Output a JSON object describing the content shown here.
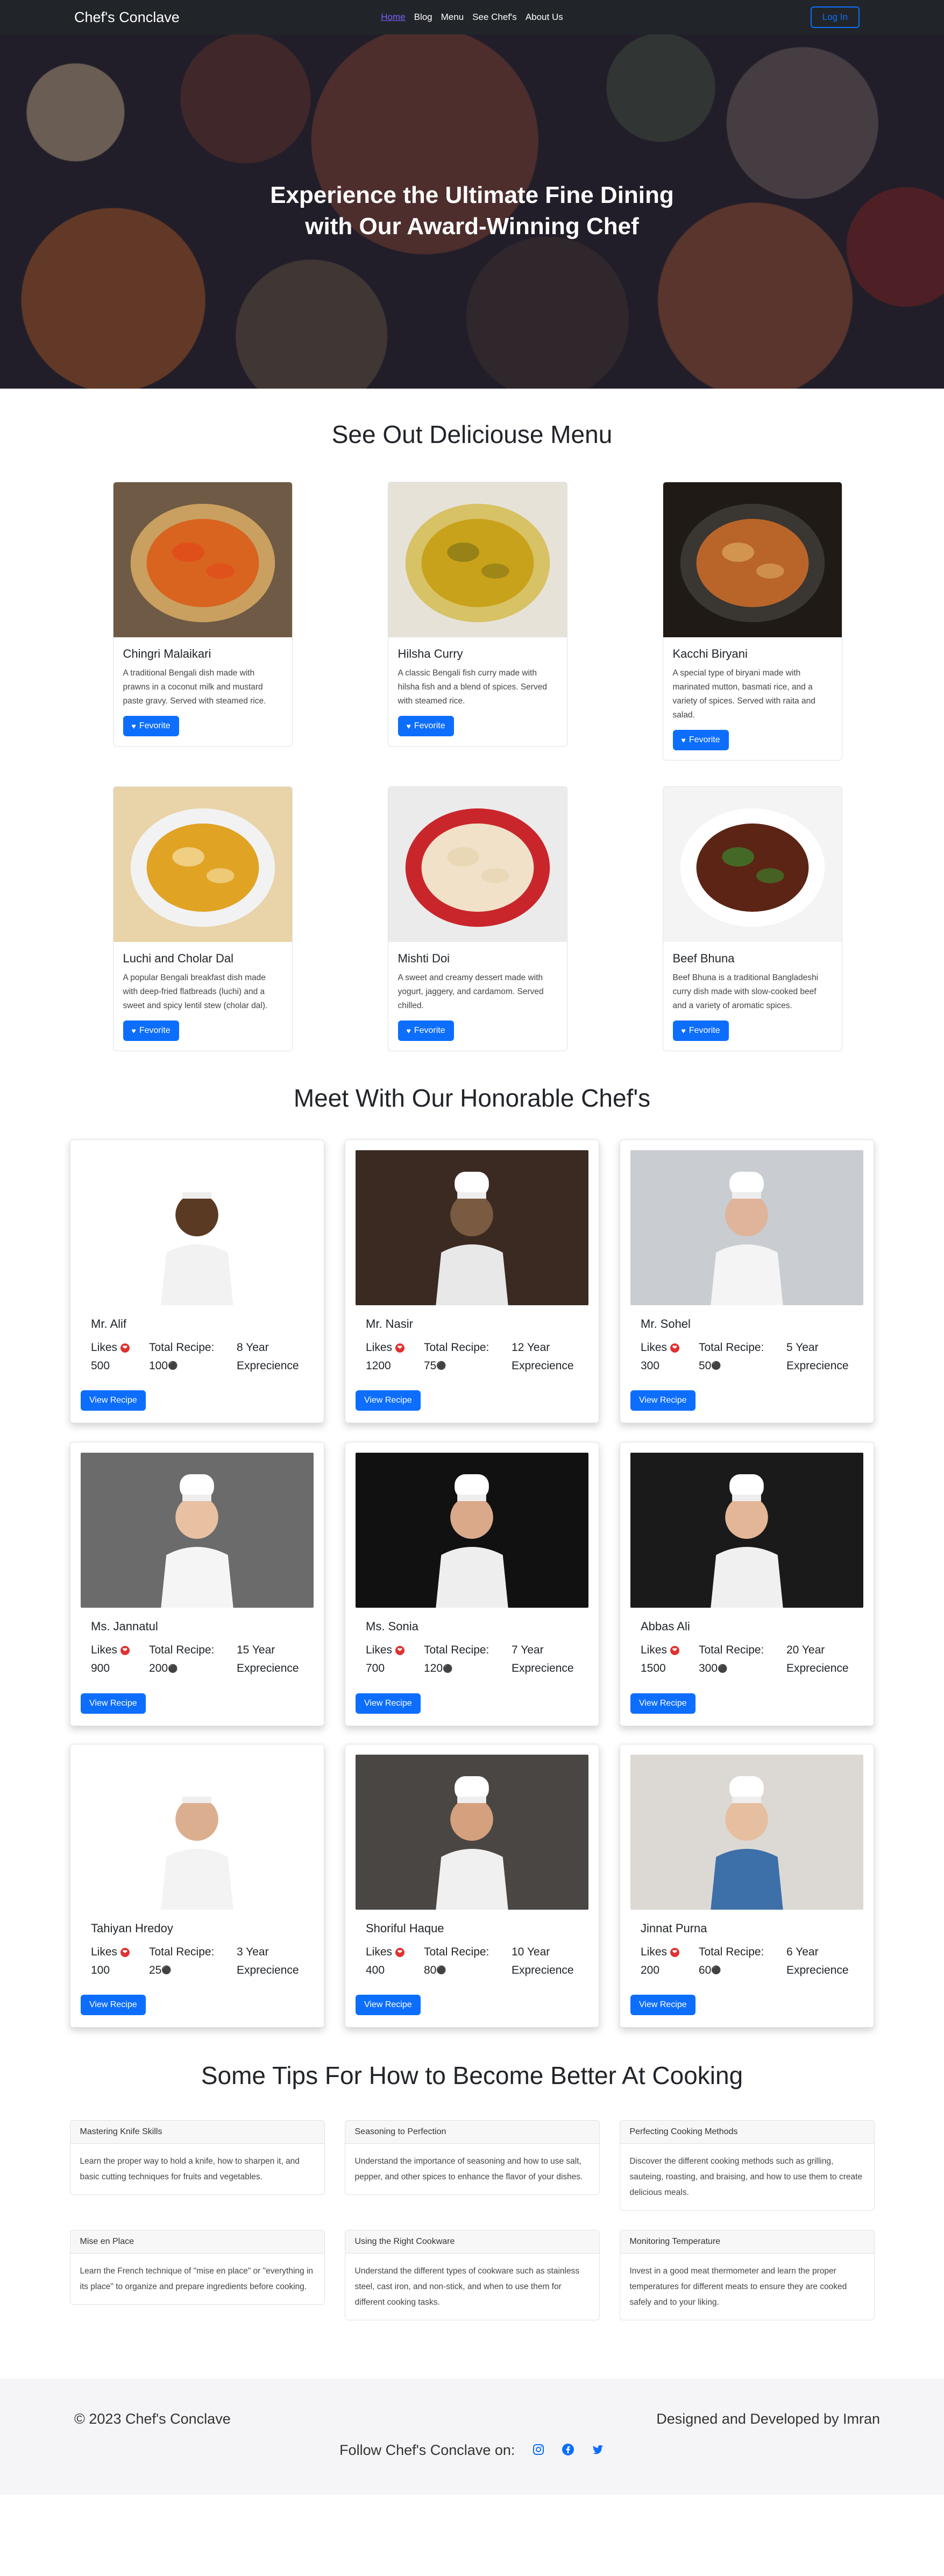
{
  "nav": {
    "brand": "Chef's Conclave",
    "links": [
      "Home",
      "Blog",
      "Menu",
      "See Chef's",
      "About Us"
    ],
    "login_label": "Log In"
  },
  "hero": {
    "title": "Experience the Ultimate Fine Dining\nwith Our Award-Winning Chef"
  },
  "menu": {
    "title": "See Out Deliciouse Menu",
    "button_label": "Fevorite",
    "items": [
      {
        "name": "Chingri Malaikari",
        "desc": "A traditional Bengali dish made with prawns in a coconut milk and mustard paste gravy. Served with steamed rice.",
        "img": "crab-curry-image"
      },
      {
        "name": "Hilsha Curry",
        "desc": "A classic Bengali fish curry made with hilsha fish and a blend of spices. Served with steamed rice.",
        "img": "fish-curry-image"
      },
      {
        "name": "Kacchi Biryani",
        "desc": "A special type of biryani made with marinated mutton, basmati rice, and a variety of spices. Served with raita and salad.",
        "img": "biryani-image"
      },
      {
        "name": "Luchi and Cholar Dal",
        "desc": "A popular Bengali breakfast dish made with deep-fried flatbreads (luchi) and a sweet and spicy lentil stew (cholar dal).",
        "img": "luchi-dal-image"
      },
      {
        "name": "Mishti Doi",
        "desc": "A sweet and creamy dessert made with yogurt, jaggery, and cardamom. Served chilled.",
        "img": "mishti-doi-image"
      },
      {
        "name": "Beef Bhuna",
        "desc": "Beef Bhuna is a traditional Bangladeshi curry dish made with slow-cooked beef and a variety of aromatic spices.",
        "img": "beef-bhuna-image"
      }
    ]
  },
  "chefs": {
    "title": "Meet With Our Honorable Chef's",
    "button_label": "View Recipe",
    "likes_label": "Likes",
    "recipes_label": "Total Recipe:",
    "list": [
      {
        "name": "Mr. Alif",
        "likes": "500",
        "recipes": "100",
        "experience": "8 Year Exprecience",
        "bg": "#ffffff",
        "coat": "#f2f2f2",
        "skin": "#5a3a22"
      },
      {
        "name": "Mr. Nasir",
        "likes": "1200",
        "recipes": "75",
        "experience": "12 Year Exprecience",
        "bg": "#3a2a22",
        "coat": "#e8e8e8",
        "skin": "#7a5a40"
      },
      {
        "name": "Mr. Sohel",
        "likes": "300",
        "recipes": "50",
        "experience": "5 Year Exprecience",
        "bg": "#c9ccd0",
        "coat": "#f4f4f4",
        "skin": "#e0b49a"
      },
      {
        "name": "Ms. Jannatul",
        "likes": "900",
        "recipes": "200",
        "experience": "15 Year Exprecience",
        "bg": "#6b6b6b",
        "coat": "#f5f5f5",
        "skin": "#e8c0a2"
      },
      {
        "name": "Ms. Sonia",
        "likes": "700",
        "recipes": "120",
        "experience": "7 Year Exprecience",
        "bg": "#111111",
        "coat": "#eeeeee",
        "skin": "#d9a98a"
      },
      {
        "name": "Abbas Ali",
        "likes": "1500",
        "recipes": "300",
        "experience": "20 Year Exprecience",
        "bg": "#1a1a1a",
        "coat": "#f0f0f0",
        "skin": "#e2b696"
      },
      {
        "name": "Tahiyan Hredoy",
        "likes": "100",
        "recipes": "25",
        "experience": "3 Year Exprecience",
        "bg": "#ffffff",
        "coat": "#f3f3f3",
        "skin": "#dcae90"
      },
      {
        "name": "Shoriful Haque",
        "likes": "400",
        "recipes": "80",
        "experience": "10 Year Exprecience",
        "bg": "#4a4644",
        "coat": "#f0f0f0",
        "skin": "#d4a07e"
      },
      {
        "name": "Jinnat Purna",
        "likes": "200",
        "recipes": "60",
        "experience": "6 Year Exprecience",
        "bg": "#dcd9d4",
        "coat": "#3d6fa8",
        "skin": "#e6bea0"
      }
    ]
  },
  "tips": {
    "title": "Some Tips For How to Become Better At Cooking",
    "list": [
      {
        "heading": "Mastering Knife Skills",
        "body": "Learn the proper way to hold a knife, how to sharpen it, and basic cutting techniques for fruits and vegetables."
      },
      {
        "heading": "Seasoning to Perfection",
        "body": "Understand the importance of seasoning and how to use salt, pepper, and other spices to enhance the flavor of your dishes."
      },
      {
        "heading": "Perfecting Cooking Methods",
        "body": "Discover the different cooking methods such as grilling, sauteing, roasting, and braising, and how to use them to create delicious meals."
      },
      {
        "heading": "Mise en Place",
        "body": "Learn the French technique of \"mise en place\" or \"everything in its place\" to organize and prepare ingredients before cooking."
      },
      {
        "heading": "Using the Right Cookware",
        "body": "Understand the different types of cookware such as stainless steel, cast iron, and non-stick, and when to use them for different cooking tasks."
      },
      {
        "heading": "Monitoring Temperature",
        "body": "Invest in a good meat thermometer and learn the proper temperatures for different meats to ensure they are cooked safely and to your liking."
      }
    ]
  },
  "footer": {
    "copyright": "© 2023 Chef's Conclave",
    "credit": "Designed and Developed by Imran",
    "follow": "Follow Chef's Conclave on:",
    "social": [
      "instagram-icon",
      "facebook-icon",
      "twitter-icon"
    ]
  }
}
